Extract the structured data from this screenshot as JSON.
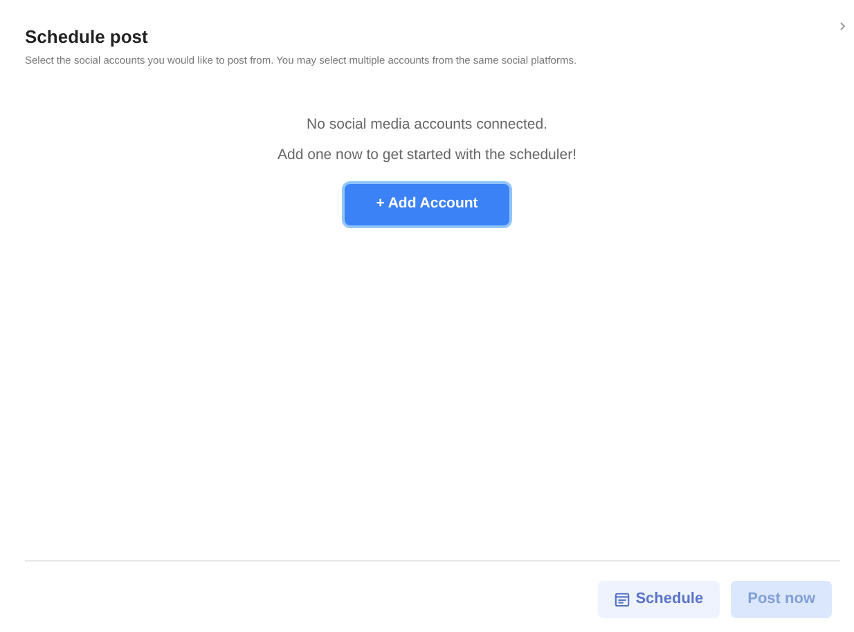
{
  "dialog": {
    "title": "Schedule post",
    "description": "Select the social accounts you would like to post from. You may select multiple accounts from the same social platforms."
  },
  "empty_state": {
    "lines": [
      "No social media accounts connected.",
      "Add one now to get started with the scheduler!"
    ],
    "button": "+ Add Account"
  },
  "footer_buttons": [
    {
      "label": "Schedule",
      "kind": "secondary",
      "disabled": false
    },
    {
      "label": "Post now",
      "kind": "primary",
      "disabled": true
    }
  ]
}
